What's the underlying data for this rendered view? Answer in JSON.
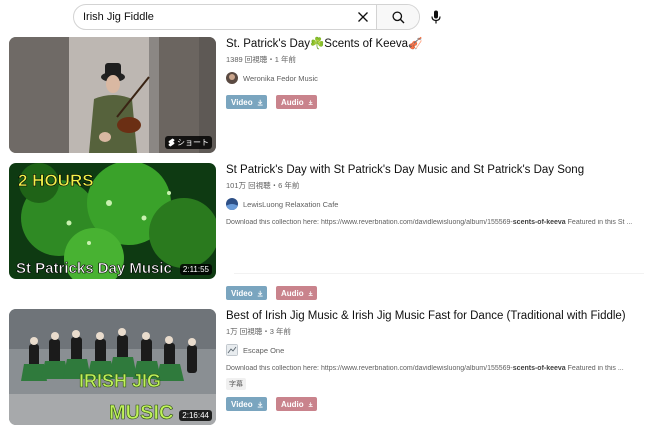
{
  "search": {
    "query": "Irish Jig Fiddle"
  },
  "icons": {
    "clear": "close-icon",
    "search": "search-icon",
    "mic": "microphone-icon",
    "download": "download-icon",
    "shorts": "shorts-icon"
  },
  "colors": {
    "video_button": "#7aa5bf",
    "audio_button": "#c9838c"
  },
  "results": [
    {
      "title": "St. Patrick's Day☘️Scents of Keeva🎻",
      "meta": "1389 回視聴・1 年前",
      "channel": "Weronika Fedor Music",
      "badge": "ショート",
      "video_label": "Video",
      "audio_label": "Audio"
    },
    {
      "title": "St Patrick's Day with St Patrick's Day Music and St Patrick's Day Song",
      "meta": "101万 回視聴・6 年前",
      "channel": "LewisLuong Relaxation Cafe",
      "desc_before": "Download this collection here: https://www.reverbnation.com/davidlewisluong/album/155569-",
      "desc_bold": "scents-of-keeva",
      "desc_after": " Featured in this St ...",
      "thumb_text_top": "2 HOURS",
      "thumb_text_bottom": "St Patricks Day Music",
      "badge": "2:11:55",
      "video_label": "Video",
      "audio_label": "Audio"
    },
    {
      "title": "Best of Irish Jig Music & Irish Jig Music Fast for Dance (Traditional with Fiddle)",
      "meta": "1万 回視聴・3 年前",
      "channel": "Escape One",
      "desc_before": "Download this collection here: https://www.reverbnation.com/davidlewisluong/album/155569-",
      "desc_bold": "scents-of-keeva",
      "desc_after": " Featured in this ...",
      "tag": "字幕",
      "thumb_text_top": "IRISH JIG",
      "thumb_text_bottom": "MUSIC",
      "badge": "2:16:44",
      "video_label": "Video",
      "audio_label": "Audio"
    }
  ]
}
